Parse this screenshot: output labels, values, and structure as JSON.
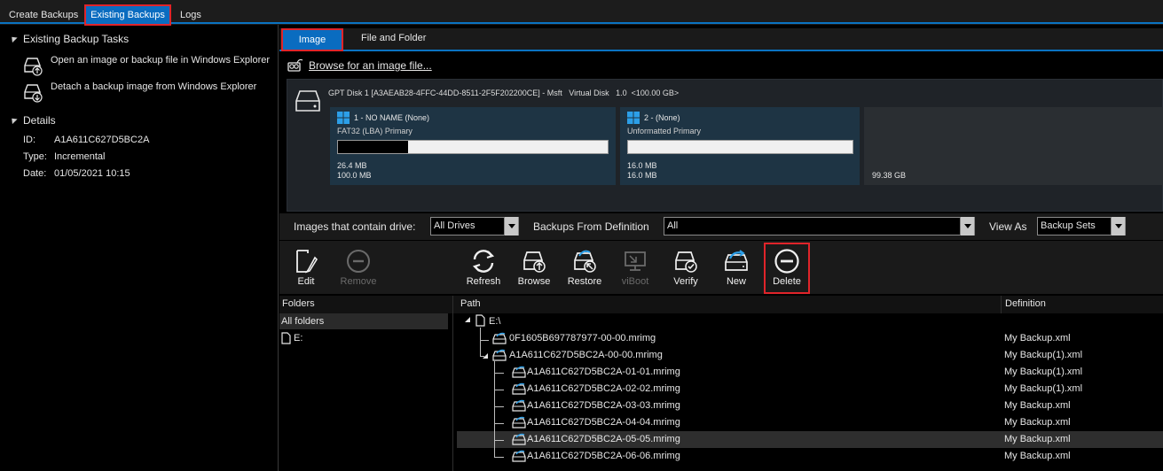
{
  "top_tabs": [
    "Create Backups",
    "Existing Backups",
    "Logs"
  ],
  "left": {
    "tasks_heading": "Existing Backup Tasks",
    "tasks": [
      "Open an image or backup file in Windows Explorer",
      "Detach a backup image from Windows Explorer"
    ],
    "details_heading": "Details",
    "details": [
      {
        "label": "ID:",
        "value": "A1A611C627D5BC2A"
      },
      {
        "label": "Type:",
        "value": "Incremental"
      },
      {
        "label": "Date:",
        "value": "01/05/2021 10:15"
      }
    ]
  },
  "sub_tabs": [
    "Image",
    "File and Folder"
  ],
  "browse_link": "Browse for an image file...",
  "disk": {
    "header": "GPT Disk 1 [A3AEAB28-4FFC-44DD-8511-2F5F202200CE] - Msft   Virtual Disk   1.0  <100.00 GB>",
    "partitions": [
      {
        "title": "1 - NO NAME (None)",
        "sub": "FAT32 (LBA) Primary",
        "used_fraction": 0.26,
        "used": "26.4 MB",
        "total": "100.0 MB"
      },
      {
        "title": "2 - (None)",
        "sub": "Unformatted Primary",
        "used_fraction": 0.0,
        "used": "16.0 MB",
        "total": "16.0 MB"
      }
    ],
    "unallocated": "99.38 GB"
  },
  "filters": {
    "images_label": "Images that contain drive:",
    "images_value": "All Drives",
    "definition_label": "Backups From Definition",
    "definition_value": "All",
    "view_label": "View As",
    "view_value": "Backup Sets"
  },
  "toolbar": {
    "edit": "Edit",
    "remove": "Remove",
    "refresh": "Refresh",
    "browse": "Browse",
    "restore": "Restore",
    "viboot": "viBoot",
    "verify": "Verify",
    "new": "New",
    "delete": "Delete"
  },
  "grid": {
    "folders_header": "Folders",
    "path_header": "Path",
    "definition_header": "Definition",
    "all_folders": "All folders",
    "folder_items": [
      "E:"
    ],
    "root": "E:\\",
    "rows": [
      {
        "name": "0F1605B697787977-00-00.mrimg",
        "def": "My Backup.xml"
      },
      {
        "name": "A1A611C627D5BC2A-00-00.mrimg",
        "def": "My Backup(1).xml"
      },
      {
        "name": "A1A611C627D5BC2A-01-01.mrimg",
        "def": "My Backup(1).xml"
      },
      {
        "name": "A1A611C627D5BC2A-02-02.mrimg",
        "def": "My Backup(1).xml"
      },
      {
        "name": "A1A611C627D5BC2A-03-03.mrimg",
        "def": "My Backup.xml"
      },
      {
        "name": "A1A611C627D5BC2A-04-04.mrimg",
        "def": "My Backup.xml"
      },
      {
        "name": "A1A611C627D5BC2A-05-05.mrimg",
        "def": "My Backup.xml"
      },
      {
        "name": "A1A611C627D5BC2A-06-06.mrimg",
        "def": "My Backup.xml"
      }
    ]
  },
  "colors": {
    "accent": "#0a6cc0",
    "highlight_border": "#e0242a",
    "partition_bg": "#1e3444"
  }
}
